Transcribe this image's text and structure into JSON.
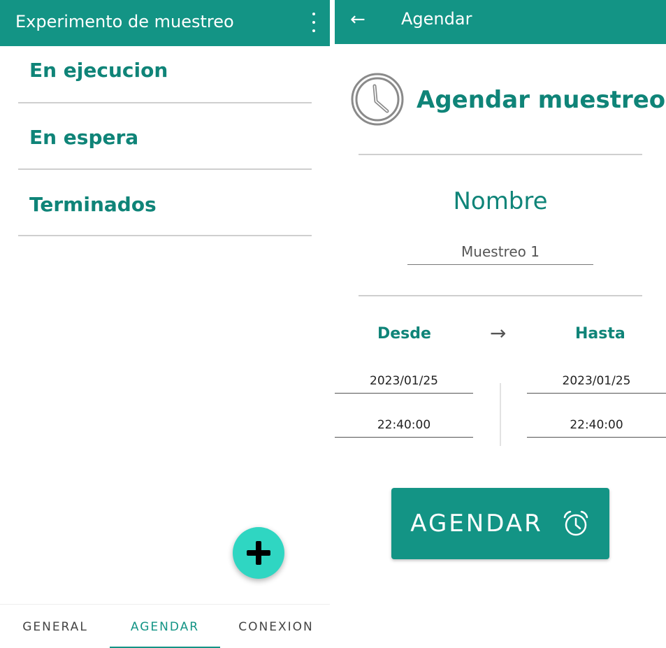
{
  "left_screen": {
    "app_title": "Experimento de muestreo",
    "sections": [
      {
        "label": "En ejecucion"
      },
      {
        "label": "En espera"
      },
      {
        "label": "Terminados"
      }
    ],
    "fab_icon": "plus-icon",
    "bottom_nav": {
      "tabs": [
        {
          "label": "GENERAL"
        },
        {
          "label": "AGENDAR"
        },
        {
          "label": "CONEXION"
        }
      ],
      "selected": "AGENDAR"
    }
  },
  "right_screen": {
    "app_title": "Agendar",
    "header_title": "Agendar muestreo",
    "name_label": "Nombre",
    "name_value": "Muestreo 1",
    "from_label": "Desde",
    "to_label": "Hasta",
    "arrow_glyph": "→",
    "from_date": "2023/01/25",
    "from_time": "22:40:00",
    "to_date": "2023/01/25",
    "to_time": "22:40:00",
    "button_label": "AGENDAR",
    "button_icon": "alarm-clock-icon"
  },
  "colors": {
    "primary": "#139485",
    "primary_text": "#0f8478",
    "fab": "#2fd6c2",
    "divider": "#cfcfcf"
  }
}
